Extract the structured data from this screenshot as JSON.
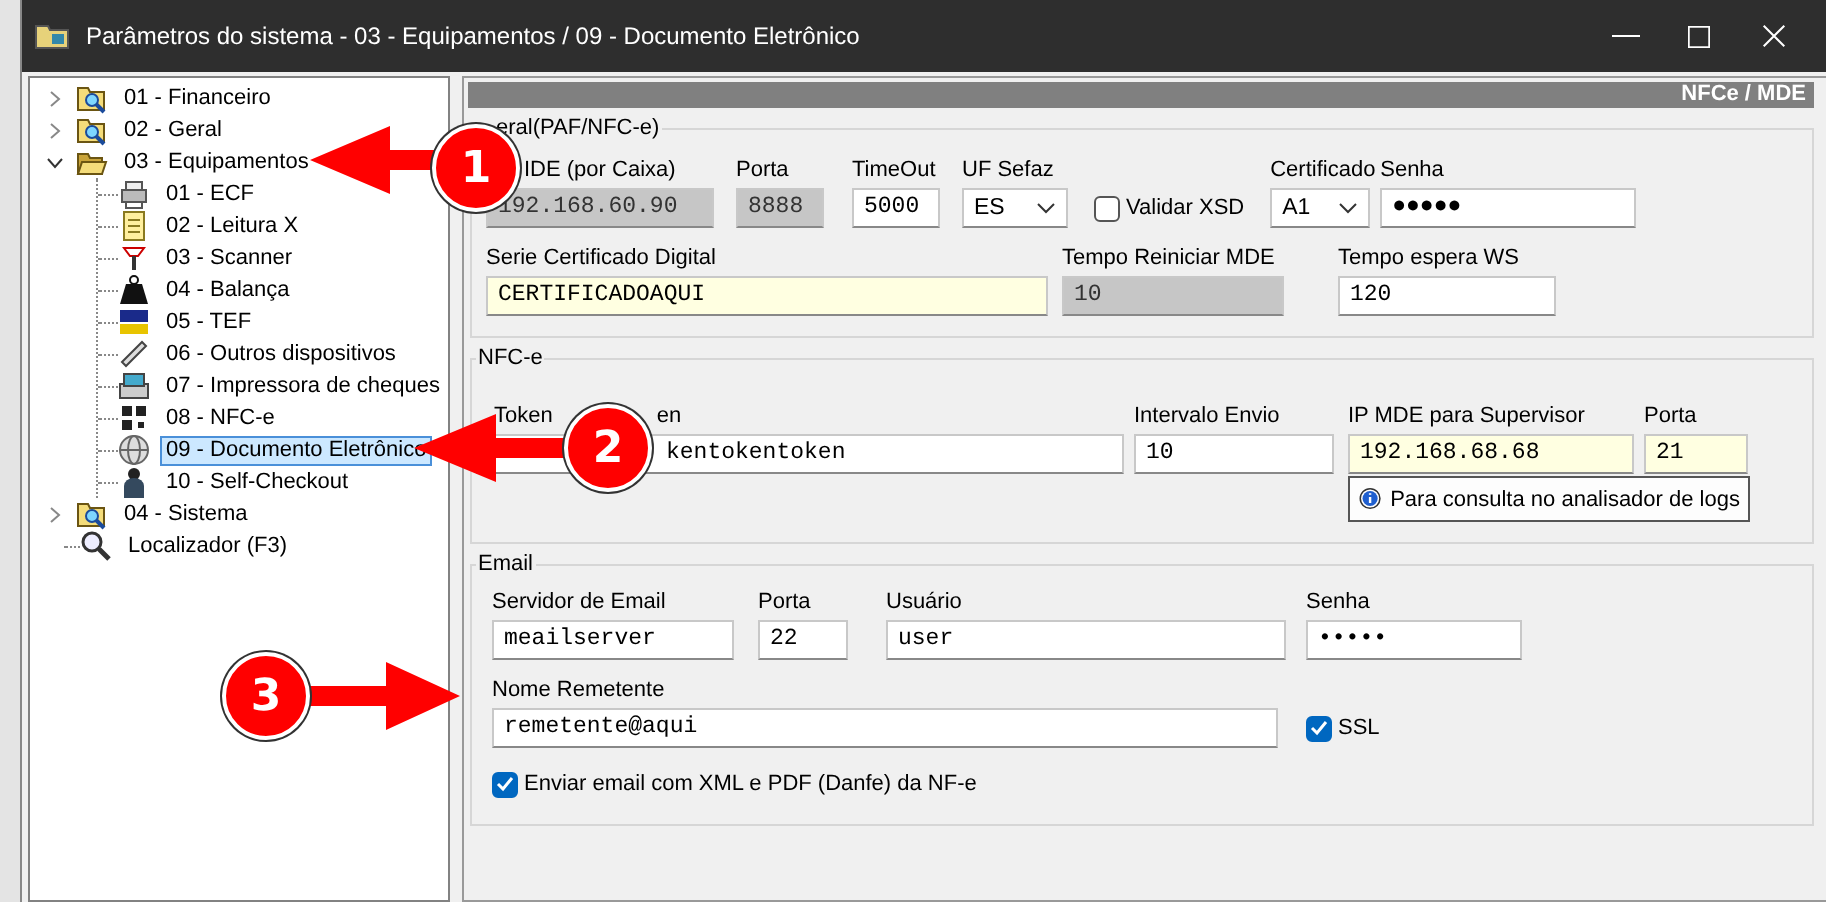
{
  "window": {
    "title": "Parâmetros do sistema - 03 - Equipamentos / 09 - Documento Eletrônico"
  },
  "tree": {
    "items": [
      {
        "label": "01 - Financeiro",
        "expanded": false,
        "selected": false
      },
      {
        "label": "02 - Geral",
        "expanded": false,
        "selected": false
      },
      {
        "label": "03 - Equipamentos",
        "expanded": true,
        "selected": false,
        "children": [
          {
            "label": "01 - ECF",
            "selected": false
          },
          {
            "label": "02 - Leitura X",
            "selected": false
          },
          {
            "label": "03 - Scanner",
            "selected": false
          },
          {
            "label": "04 - Balança",
            "selected": false
          },
          {
            "label": "05 - TEF",
            "selected": false
          },
          {
            "label": "06 - Outros dispositivos",
            "selected": false
          },
          {
            "label": "07 - Impressora de cheques",
            "selected": false
          },
          {
            "label": "08 - NFC-e",
            "selected": false
          },
          {
            "label": "09 - Documento Eletrônico",
            "selected": true
          },
          {
            "label": "10 - Self-Checkout",
            "selected": false
          }
        ]
      },
      {
        "label": "04 - Sistema",
        "expanded": false,
        "selected": false
      }
    ],
    "locator": {
      "label": "Localizador (F3)"
    }
  },
  "panel": {
    "header": "NFCe / MDE",
    "groups": [
      {
        "title": "eral(PAF/NFC-e)",
        "fields": [
          {
            "kind": "text",
            "label": "IDE (por Caixa)",
            "value": "192.168.60.90",
            "disabled": true,
            "highlighted": false
          },
          {
            "kind": "text",
            "label": "Porta",
            "value": "8888",
            "disabled": true,
            "highlighted": false
          },
          {
            "kind": "text",
            "label": "TimeOut",
            "value": "5000",
            "disabled": false,
            "highlighted": false
          },
          {
            "kind": "select",
            "label": "UF Sefaz",
            "value": "ES"
          },
          {
            "kind": "checkbox",
            "label": "Validar XSD",
            "checked": false
          },
          {
            "kind": "select",
            "label": "Certificado",
            "value": "A1"
          },
          {
            "kind": "text",
            "label": "Senha",
            "value": "●●●●●",
            "disabled": false,
            "highlighted": false
          },
          {
            "kind": "text",
            "label": "Serie Certificado Digital",
            "value": "CERTIFICADOAQUI",
            "disabled": false,
            "highlighted": true
          },
          {
            "kind": "text",
            "label": "Tempo Reiniciar MDE",
            "value": "10",
            "disabled": true,
            "highlighted": false
          },
          {
            "kind": "text",
            "label": "Tempo espera WS",
            "value": "120",
            "disabled": false,
            "highlighted": false
          }
        ]
      },
      {
        "title": "NFC-e",
        "fields": [
          {
            "kind": "text",
            "label": "Token",
            "label_end": "en",
            "value": "kentokentoken",
            "disabled": false,
            "highlighted": false
          },
          {
            "kind": "text",
            "label": "Intervalo Envio",
            "value": "10",
            "disabled": false,
            "highlighted": false
          },
          {
            "kind": "text",
            "label": "IP MDE para Supervisor",
            "value": "192.168.68.68",
            "disabled": false,
            "highlighted": true
          },
          {
            "kind": "text",
            "label": "Porta",
            "value": "21",
            "disabled": false,
            "highlighted": true
          },
          {
            "kind": "button",
            "label": "Para consulta no analisador de logs"
          }
        ]
      },
      {
        "title": "Email",
        "fields": [
          {
            "kind": "text",
            "label": "Servidor de Email",
            "value": "meailserver",
            "disabled": false,
            "highlighted": false
          },
          {
            "kind": "text",
            "label": "Porta",
            "value": "22",
            "disabled": false,
            "highlighted": false
          },
          {
            "kind": "text",
            "label": "Usuário",
            "value": "user",
            "disabled": false,
            "highlighted": false
          },
          {
            "kind": "text",
            "label": "Senha",
            "value": "•••••",
            "disabled": false,
            "highlighted": false
          },
          {
            "kind": "text",
            "label": "Nome Remetente",
            "value": "remetente@aqui",
            "disabled": false,
            "highlighted": false
          },
          {
            "kind": "checkbox",
            "label": "SSL",
            "checked": true
          },
          {
            "kind": "checkbox",
            "label": "Enviar email com XML e PDF (Danfe) da NF-e",
            "checked": true
          }
        ]
      }
    ]
  },
  "callouts": [
    {
      "number": "1"
    },
    {
      "number": "2"
    },
    {
      "number": "3"
    }
  ]
}
